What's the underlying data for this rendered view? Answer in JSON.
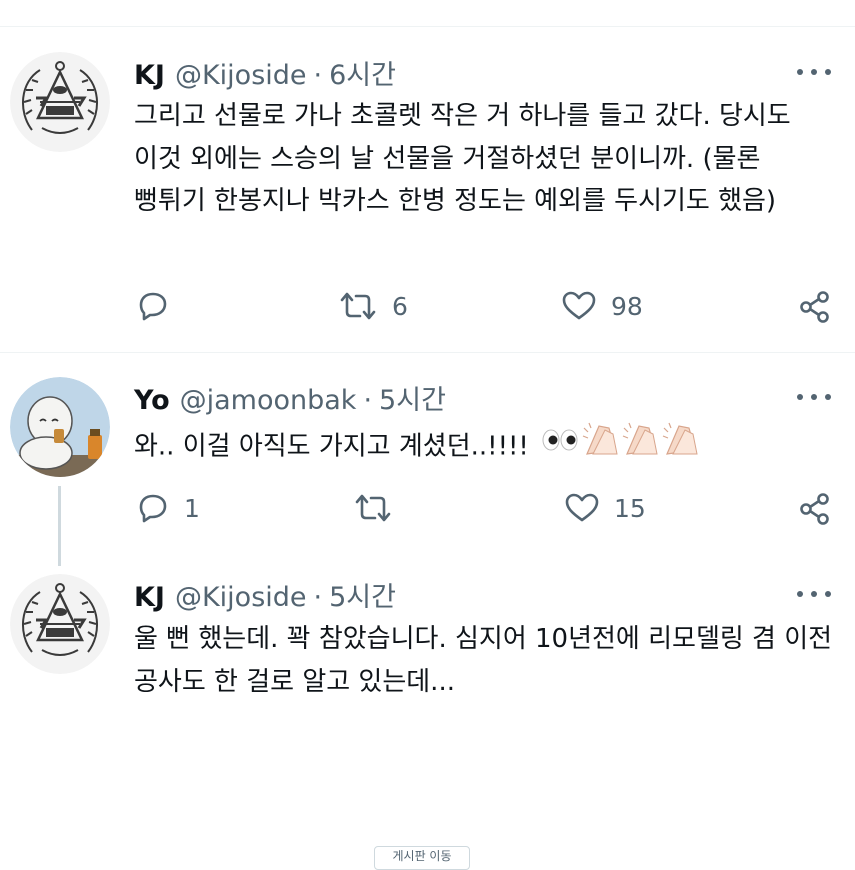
{
  "tweets": [
    {
      "name": "KJ",
      "handle": "@Kijoside",
      "separator": "·",
      "time": "6시간",
      "text": "그리고 선물로 가나 초콜렛 작은 거 하나를 들고 갔다. 당시도 이것 외에는 스승의 날 선물을 거절하셨던 분이니까. (물론 뻥튀기 한봉지나 박카스 한병 정도는 예외를 두시기도 했음)",
      "reply_count": "",
      "retweet_count": "6",
      "like_count": "98"
    },
    {
      "name": "Yo",
      "handle": "@jamoonbak",
      "separator": "·",
      "time": "5시간",
      "text": "와.. 이걸 아직도 가지고 계셨던..!!!!",
      "emojis": [
        "eyes-emoji",
        "clapping-hands-emoji",
        "clapping-hands-emoji",
        "clapping-hands-emoji"
      ],
      "reply_count": "1",
      "retweet_count": "",
      "like_count": "15"
    },
    {
      "name": "KJ",
      "handle": "@Kijoside",
      "separator": "·",
      "time": "5시간",
      "text": "울 뻔 했는데. 꽉 참았습니다. 심지어 10년전에 리모델링 겸 이전 공사도 한 걸로 알고 있는데..."
    }
  ],
  "bottom_button": {
    "label": "게시판 이동"
  },
  "colors": {
    "text": "#0f1419",
    "secondary": "#536471",
    "divider": "#eff3f4",
    "thread_line": "#cfd9de"
  },
  "icons": [
    "reply-icon",
    "retweet-icon",
    "like-icon",
    "share-icon",
    "more-icon"
  ]
}
